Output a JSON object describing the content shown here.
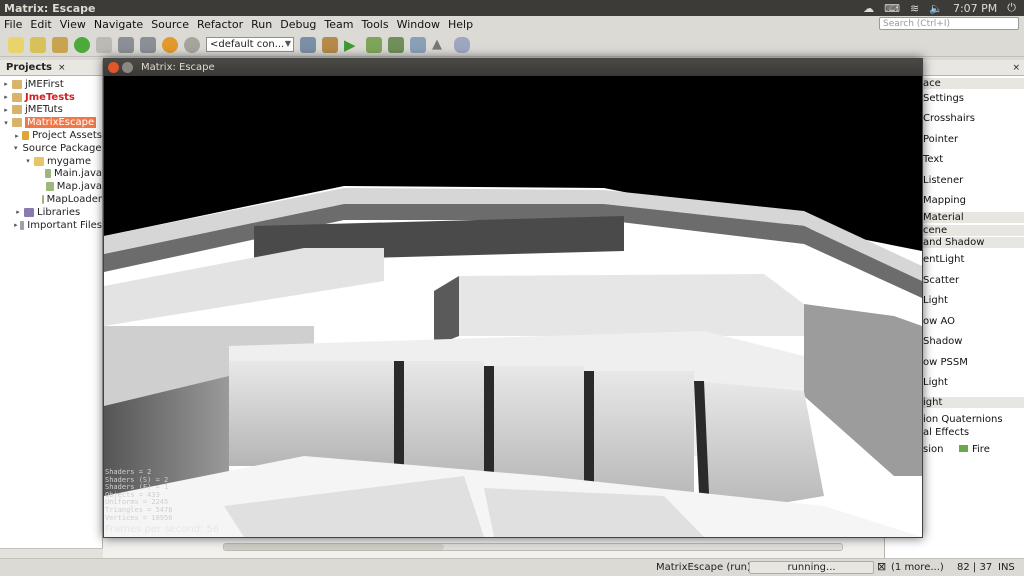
{
  "window_title": "Matrix: Escape",
  "tray": {
    "time": "7:07 PM"
  },
  "menu": [
    "File",
    "Edit",
    "View",
    "Navigate",
    "Source",
    "Refactor",
    "Run",
    "Debug",
    "Team",
    "Tools",
    "Window",
    "Help"
  ],
  "search": {
    "placeholder": "Search (Ctrl+I)"
  },
  "toolbar": {
    "config": "<default con..."
  },
  "projects": {
    "tab": "Projects",
    "close": "×",
    "items": [
      {
        "label": "jMEFirst",
        "toggle": "▸"
      },
      {
        "label": "JmeTests",
        "toggle": "▸"
      },
      {
        "label": "jMETuts",
        "toggle": "▸"
      },
      {
        "label": "MatrixEscape",
        "toggle": "▾"
      },
      {
        "label": "Project Assets",
        "toggle": "▸"
      },
      {
        "label": "Source Packages",
        "toggle": "▾"
      },
      {
        "label": "mygame",
        "toggle": "▾"
      },
      {
        "label": "Main.java",
        "toggle": ""
      },
      {
        "label": "Map.java",
        "toggle": ""
      },
      {
        "label": "MapLoader",
        "toggle": ""
      },
      {
        "label": "Libraries",
        "toggle": "▸"
      },
      {
        "label": "Important Files",
        "toggle": "▸"
      }
    ]
  },
  "palette": {
    "close": "×",
    "items": [
      "ace",
      "Settings",
      "Crosshairs",
      "Pointer",
      "Text",
      "Listener",
      "Mapping",
      "Material",
      "cene",
      "and Shadow",
      "entLight",
      "Scatter",
      "Light",
      "ow AO",
      "Shadow",
      "ow PSSM",
      "Light",
      "ight",
      "ion Quaternions",
      "al Effects",
      "sion",
      "Fire"
    ]
  },
  "game": {
    "title": "Matrix: Escape",
    "stats": [
      "Shaders = 2",
      "Shaders (S) = 2",
      "Shaders (F) = 1",
      "Objects = 433",
      "Uniforms = 2245",
      "Triangles = 5478",
      "Vertices = 10956"
    ],
    "fps": "Frames per second: 56"
  },
  "status": {
    "task": "MatrixEscape (run)",
    "progress": "running...",
    "more": "(1 more...)",
    "position": "82 | 37",
    "mode": "INS"
  }
}
